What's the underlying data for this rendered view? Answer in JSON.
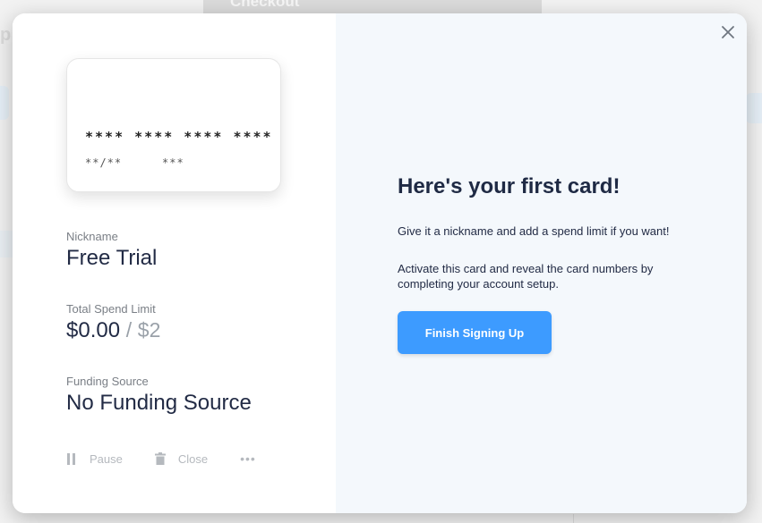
{
  "background": {
    "topbar_text": "Checkout",
    "left_letter": "p"
  },
  "card": {
    "number_masked": "**** **** **** ****",
    "expiry_masked": "**/**",
    "cvv_masked": "***"
  },
  "fields": {
    "nickname_label": "Nickname",
    "nickname_value": "Free Trial",
    "limit_label": "Total Spend Limit",
    "limit_spent": "$0.00",
    "limit_separator": "/",
    "limit_total": "$2",
    "funding_label": "Funding Source",
    "funding_value": "No Funding Source"
  },
  "actions": {
    "pause_label": "Pause",
    "close_label": "Close",
    "more_label": "•••"
  },
  "panel": {
    "heading": "Here's your first card!",
    "line1": "Give it a nickname and add a spend limit if you want!",
    "line2": "Activate this card and reveal the card numbers by completing your account setup.",
    "cta_label": "Finish Signing Up"
  },
  "colors": {
    "accent": "#3d9bff",
    "text_dark": "#222b45",
    "muted": "#7a7f86",
    "panel_bg": "#f4f8fc"
  },
  "icons": {
    "close": "close-icon",
    "pause": "pause-icon",
    "trash": "trash-icon",
    "more": "more-icon"
  }
}
